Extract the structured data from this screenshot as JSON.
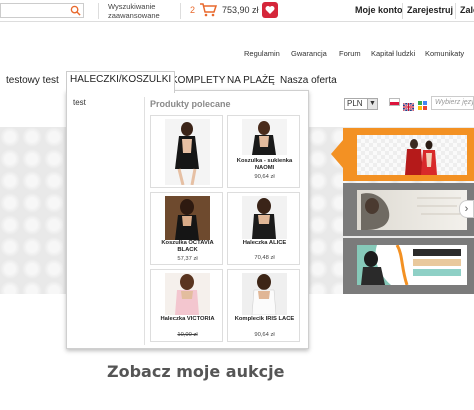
{
  "topbar": {
    "adv_search_line1": "Wyszukiwanie",
    "adv_search_line2": "zaawansowane",
    "cart_count": "2",
    "cart_total": "753,90 zł",
    "links": [
      "Moje konto",
      "Zarejestruj",
      "Zalo"
    ]
  },
  "secondary_links": [
    "Regulamin",
    "Gwarancja",
    "Forum",
    "Kapitał ludzki",
    "Komunikaty"
  ],
  "nav": {
    "items": [
      "testowy test",
      "HALECZKI/KOSZULKI",
      "KOMPLETY",
      "NA PLAŻĘ",
      "Nasza oferta"
    ],
    "active_index": 1
  },
  "currency": {
    "selected": "PLN"
  },
  "site_search": {
    "placeholder": "Wybierz język"
  },
  "dropdown": {
    "subcategory": "test",
    "section_title": "Produkty polecane",
    "products": [
      {
        "name": "",
        "price": ""
      },
      {
        "name": "Koszulka - sukienka NAOMI",
        "price": "90,64 zł"
      },
      {
        "name": "Koszulka OCTAVIA BLACK",
        "price": "57,37 zł"
      },
      {
        "name": "Haleczka ALICE",
        "price": "70,48 zł"
      },
      {
        "name": "Haleczka VICTORIA",
        "price": "10,00 zł"
      },
      {
        "name": "Komplecik IRIS LACE",
        "price": "90,64 zł"
      }
    ]
  },
  "headline": "Zobacz moje aukcje",
  "colors": {
    "accent": "#f39123",
    "heart": "#d5263a",
    "banner_gray": "#7b7b7b"
  }
}
